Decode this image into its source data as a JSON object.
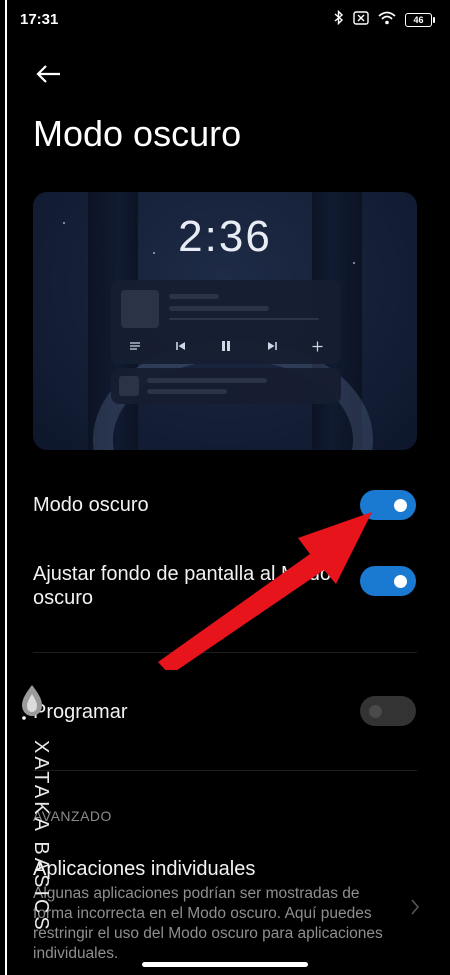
{
  "status_bar": {
    "time": "17:31",
    "battery": "46",
    "icons": [
      "bluetooth-icon",
      "sim-off-icon",
      "wifi-icon",
      "battery-icon"
    ]
  },
  "header": {
    "title": "Modo oscuro"
  },
  "preview": {
    "clock": "2:36"
  },
  "settings": [
    {
      "label": "Modo oscuro",
      "toggle_on": true
    },
    {
      "label": "Ajustar fondo de pantalla al Modo oscuro",
      "toggle_on": true
    },
    {
      "label": "Programar",
      "toggle_on": false
    }
  ],
  "advanced": {
    "header": "AVANZADO",
    "item_title": "Aplicaciones individuales",
    "item_description": "Algunas aplicaciones podrían ser mostradas de forma incorrecta en el Modo oscuro. Aquí puedes restringir el uso del Modo oscuro para aplicaciones individuales."
  },
  "watermark": {
    "text": "XATAKA BASICS"
  },
  "colors": {
    "accent": "#1a79d1",
    "annotation_arrow": "#e8141c",
    "background": "#000000"
  }
}
